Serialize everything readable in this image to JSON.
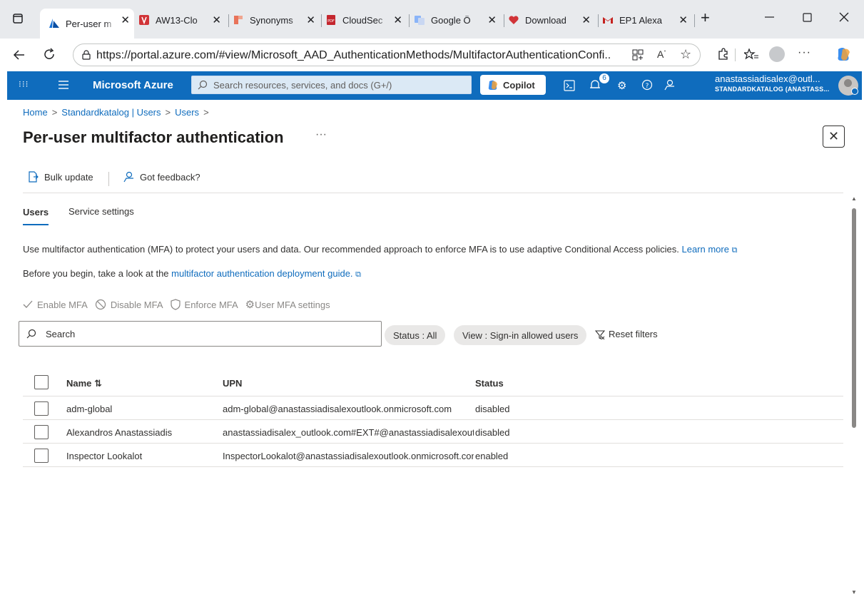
{
  "browser": {
    "tabs": [
      {
        "label": "Per-user m",
        "icon": "azure-icon"
      },
      {
        "label": "AW13-Clo",
        "icon": "shield-red-icon"
      },
      {
        "label": "Synonyms",
        "icon": "thesaurus-icon"
      },
      {
        "label": "CloudSec",
        "icon": "pdf-icon"
      },
      {
        "label": "Google Ö",
        "icon": "translate-icon"
      },
      {
        "label": "Download",
        "icon": "heart-icon"
      },
      {
        "label": "EP1 Alexa",
        "icon": "gmail-icon"
      }
    ],
    "url": "https://portal.azure.com/#view/Microsoft_AAD_AuthenticationMethods/MultifactorAuthenticationConfi..."
  },
  "azure": {
    "brand": "Microsoft Azure",
    "search_placeholder": "Search resources, services, and docs (G+/)",
    "copilot": "Copilot",
    "notification_count": "6",
    "account_name": "anastassiadisalex@outl...",
    "account_dir": "STANDARDKATALOG (ANASTASS..."
  },
  "breadcrumb": [
    "Home",
    "Standardkatalog | Users",
    "Users"
  ],
  "page": {
    "title": "Per-user multifactor authentication",
    "ellipsis": "···"
  },
  "commands": {
    "bulk_update": "Bulk update",
    "feedback": "Got feedback?"
  },
  "tabs": {
    "users": "Users",
    "service_settings": "Service settings"
  },
  "info": {
    "p1_text": "Use multifactor authentication (MFA) to protect your users and data. Our recommended approach to enforce MFA is to use adaptive Conditional Access policies.",
    "p1_link": "Learn more",
    "p2_text": "Before you begin, take a look at the",
    "p2_link": "multifactor authentication deployment guide."
  },
  "actions": {
    "enable": "Enable MFA",
    "disable": "Disable MFA",
    "enforce": "Enforce MFA",
    "settings": "User MFA settings"
  },
  "filters": {
    "search_placeholder": "Search",
    "status": "Status : All",
    "view": "View : Sign-in allowed users",
    "reset": "Reset filters"
  },
  "table": {
    "headers": {
      "name": "Name ⇅",
      "upn": "UPN",
      "status": "Status"
    },
    "rows": [
      {
        "name": "adm-global",
        "upn": "adm-global@anastassiadisalexoutlook.onmicrosoft.com",
        "status": "disabled"
      },
      {
        "name": "Alexandros Anastassiadis",
        "upn": "anastassiadisalex_outlook.com#EXT#@anastassiadisalexoutlook.onmicrosoft.com",
        "status": "disabled"
      },
      {
        "name": "Inspector Lookalot",
        "upn": "InspectorLookalot@anastassiadisalexoutlook.onmicrosoft.com",
        "status": "enabled"
      }
    ]
  },
  "colors": {
    "azure_blue": "#0f6cbd",
    "link": "#0f6cbd",
    "tabbar": "#e8eaed"
  }
}
